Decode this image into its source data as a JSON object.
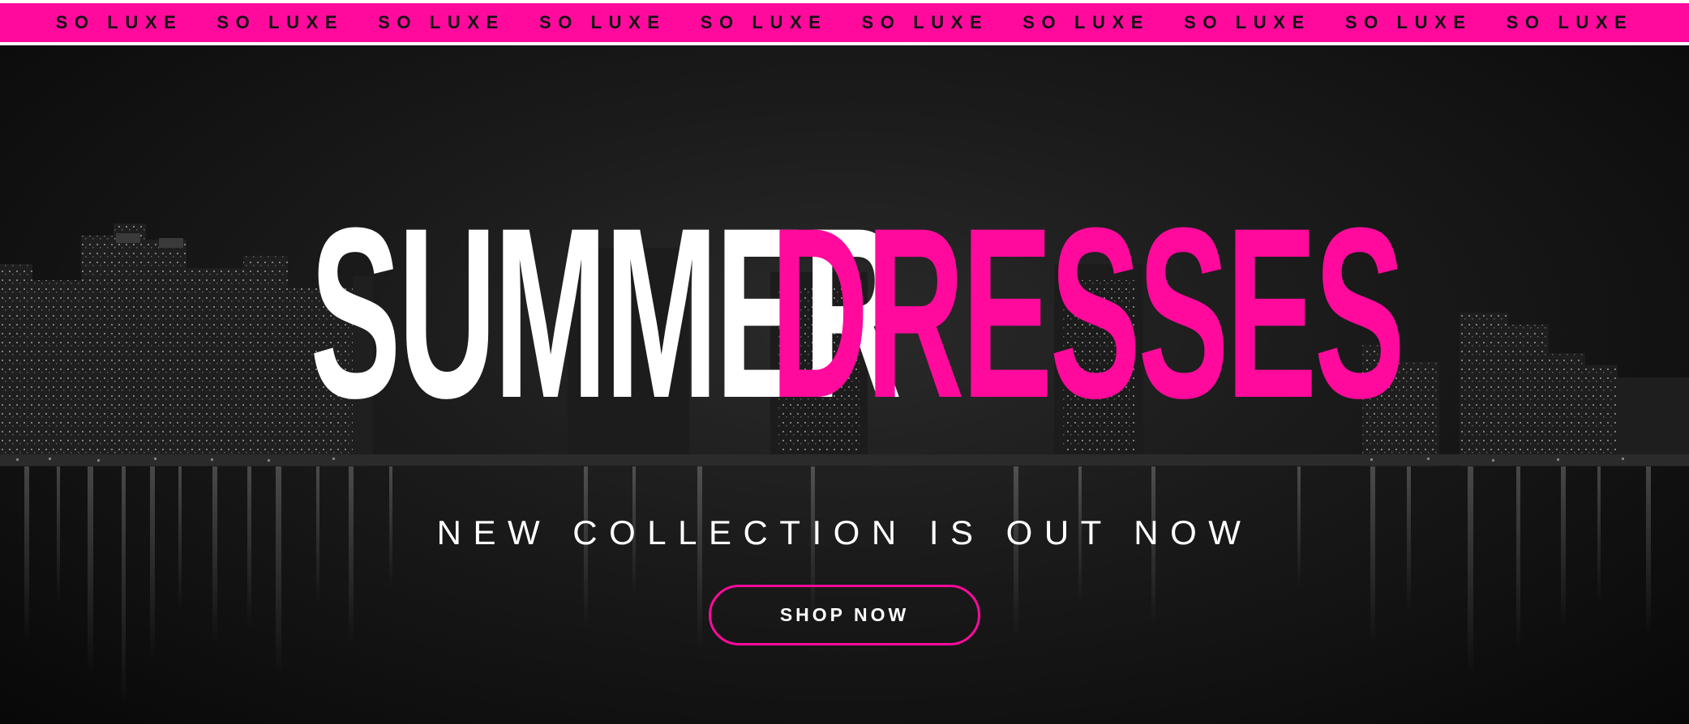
{
  "ribbon": {
    "items": [
      "SO LUXE",
      "SO LUXE",
      "SO LUXE",
      "SO LUXE",
      "SO LUXE",
      "SO LUXE",
      "SO LUXE",
      "SO LUXE",
      "SO LUXE",
      "SO LUXE"
    ],
    "background_color": "#ff0a9c",
    "text_color": "#111111"
  },
  "hero": {
    "headline_word_1": "SUMMER",
    "headline_word_2": "DRESSES",
    "headline_word_1_color": "#ffffff",
    "headline_word_2_color": "#ff0a9c",
    "subtitle": "NEW COLLECTION IS OUT NOW",
    "cta_label": "SHOP NOW",
    "accent_color": "#ff0a9c"
  }
}
